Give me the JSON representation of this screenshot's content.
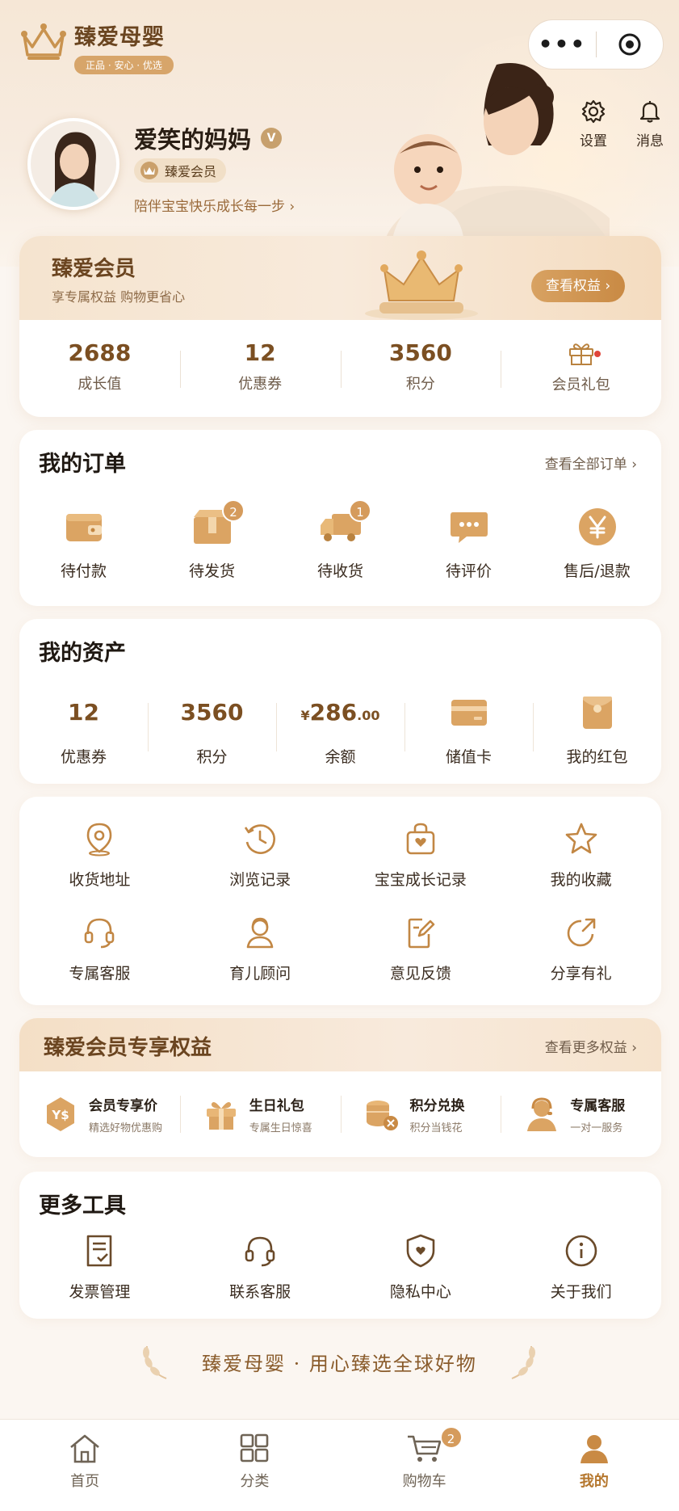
{
  "brand": {
    "name": "臻爱母婴",
    "slogan": "正品 · 安心 · 优选"
  },
  "capsule": {
    "more": "•••"
  },
  "top_actions": [
    {
      "label": "设置",
      "icon": "gear-icon"
    },
    {
      "label": "消息",
      "icon": "bell-icon"
    }
  ],
  "user": {
    "name": "爱笑的妈妈",
    "verified": "V",
    "level": "臻爱会员",
    "subtitle": "陪伴宝宝快乐成长每一步 ›"
  },
  "member_card": {
    "title": "臻爱会员",
    "subtitle": "享专属权益  购物更省心",
    "button": "查看权益 ›",
    "stats": [
      {
        "value": "2688",
        "label": "成长值"
      },
      {
        "value": "12",
        "label": "优惠券"
      },
      {
        "value": "3560",
        "label": "积分"
      },
      {
        "value": "",
        "label": "会员礼包",
        "icon": "gift-icon"
      }
    ]
  },
  "orders": {
    "title": "我的订单",
    "more": "查看全部订单 ›",
    "items": [
      {
        "label": "待付款",
        "icon": "wallet-icon",
        "badge": ""
      },
      {
        "label": "待发货",
        "icon": "box-icon",
        "badge": "2"
      },
      {
        "label": "待收货",
        "icon": "truck-icon",
        "badge": "1"
      },
      {
        "label": "待评价",
        "icon": "chat-icon",
        "badge": ""
      },
      {
        "label": "售后/退款",
        "icon": "yen-icon",
        "badge": ""
      }
    ]
  },
  "assets": {
    "title": "我的资产",
    "items": [
      {
        "value": "12",
        "label": "优惠券"
      },
      {
        "value": "3560",
        "label": "积分"
      },
      {
        "value_prefix": "¥",
        "value": "286",
        "value_suffix": ".00",
        "label": "余额"
      },
      {
        "label": "储值卡",
        "icon": "card-icon"
      },
      {
        "label": "我的红包",
        "icon": "red-packet-icon"
      }
    ]
  },
  "services": {
    "row1": [
      {
        "label": "收货地址",
        "icon": "location-icon"
      },
      {
        "label": "浏览记录",
        "icon": "history-icon"
      },
      {
        "label": "宝宝成长记录",
        "icon": "growth-bag-icon"
      },
      {
        "label": "我的收藏",
        "icon": "star-icon"
      }
    ],
    "row2": [
      {
        "label": "专属客服",
        "icon": "headset-icon"
      },
      {
        "label": "育儿顾问",
        "icon": "advisor-icon"
      },
      {
        "label": "意见反馈",
        "icon": "feedback-icon"
      },
      {
        "label": "分享有礼",
        "icon": "share-icon"
      }
    ]
  },
  "benefits": {
    "title": "臻爱会员专享权益",
    "more": "查看更多权益 ›",
    "items": [
      {
        "title": "会员专享价",
        "desc": "精选好物优惠购",
        "icon": "vip-price-icon",
        "icon_text": "Y$"
      },
      {
        "title": "生日礼包",
        "desc": "专属生日惊喜",
        "icon": "birthday-gift-icon"
      },
      {
        "title": "积分兑换",
        "desc": "积分当钱花",
        "icon": "coins-icon"
      },
      {
        "title": "专属客服",
        "desc": "一对一服务",
        "icon": "agent-icon"
      }
    ]
  },
  "tools": {
    "title": "更多工具",
    "items": [
      {
        "label": "发票管理",
        "icon": "invoice-icon"
      },
      {
        "label": "联系客服",
        "icon": "headset-icon"
      },
      {
        "label": "隐私中心",
        "icon": "shield-icon"
      },
      {
        "label": "关于我们",
        "icon": "info-icon"
      }
    ]
  },
  "footer_slogan": "臻爱母婴 · 用心臻选全球好物",
  "tabbar": [
    {
      "label": "首页",
      "icon": "home-icon",
      "active": false
    },
    {
      "label": "分类",
      "icon": "grid-icon",
      "active": false
    },
    {
      "label": "购物车",
      "icon": "cart-icon",
      "badge": "2",
      "active": false
    },
    {
      "label": "我的",
      "icon": "user-icon",
      "active": true
    }
  ],
  "colors": {
    "accent": "#c98a44",
    "brand_brown": "#6b4520",
    "badge": "#d59b5c",
    "red_dot": "#e0453a"
  }
}
